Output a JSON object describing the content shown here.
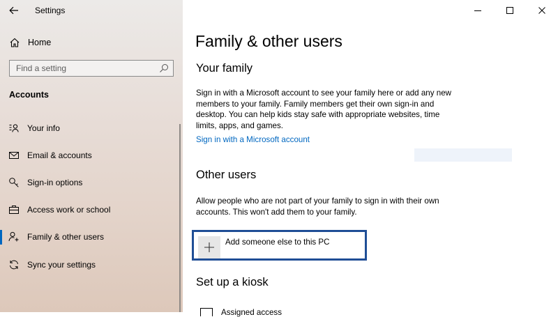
{
  "app": {
    "title": "Settings"
  },
  "sidebar": {
    "home_label": "Home",
    "search_placeholder": "Find a setting",
    "section_heading": "Accounts",
    "items": [
      {
        "label": "Your info",
        "icon": "person-card-icon"
      },
      {
        "label": "Email & accounts",
        "icon": "envelope-icon"
      },
      {
        "label": "Sign-in options",
        "icon": "key-icon"
      },
      {
        "label": "Access work or school",
        "icon": "briefcase-icon"
      },
      {
        "label": "Family & other users",
        "icon": "person-add-icon",
        "active": true
      },
      {
        "label": "Sync your settings",
        "icon": "sync-icon"
      }
    ]
  },
  "window_controls": [
    "minimize",
    "maximize",
    "close"
  ],
  "main": {
    "title": "Family & other users",
    "family": {
      "heading": "Your family",
      "description": "Sign in with a Microsoft account to see your family here or add any new members to your family. Family members get their own sign-in and desktop. You can help kids stay safe with appropriate websites, time limits, apps, and games.",
      "link": "Sign in with a Microsoft account"
    },
    "other_users": {
      "heading": "Other users",
      "description": "Allow people who are not part of your family to sign in with their own accounts. This won't add them to your family.",
      "add_button": "Add someone else to this PC"
    },
    "kiosk": {
      "heading": "Set up a kiosk",
      "item_label": "Assigned access"
    }
  },
  "colors": {
    "accent": "#0067c0",
    "highlight_border": "#1f4e96",
    "sidebar_bg": "#e7dcd6"
  }
}
